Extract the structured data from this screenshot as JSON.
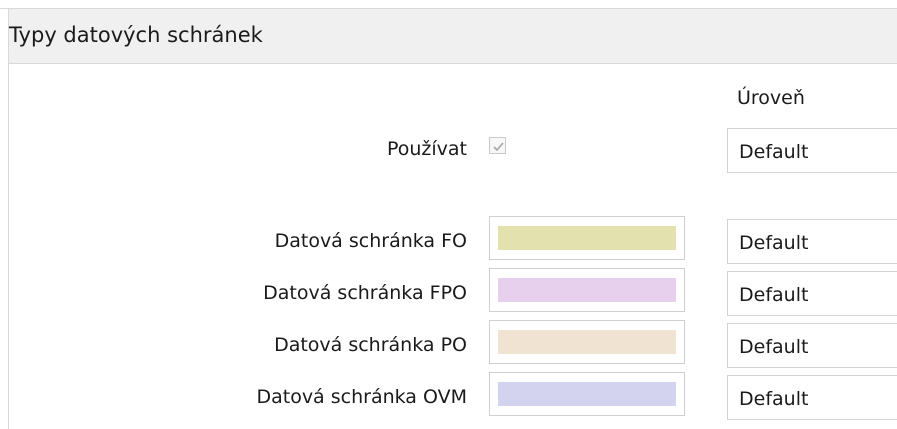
{
  "panel": {
    "title": "Typy datových schránek"
  },
  "columns": {
    "level_header": "Úroveň"
  },
  "use_row": {
    "label": "Používat",
    "checked": true,
    "level": "Default"
  },
  "mailbox_types": [
    {
      "label": "Datová schránka FO",
      "color": "#e3e1ad",
      "level": "Default"
    },
    {
      "label": "Datová schránka FPO",
      "color": "#e7d0ee",
      "level": "Default"
    },
    {
      "label": "Datová schránka PO",
      "color": "#f0e3d2",
      "level": "Default"
    },
    {
      "label": "Datová schránka OVM",
      "color": "#d3d3f0",
      "level": "Default"
    }
  ]
}
